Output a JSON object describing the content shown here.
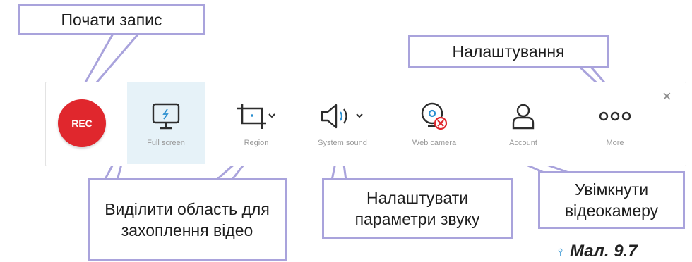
{
  "toolbar": {
    "rec_label": "REC",
    "items": [
      {
        "label": "Full screen",
        "icon": "monitor-icon"
      },
      {
        "label": "Region",
        "icon": "crop-icon"
      },
      {
        "label": "System sound",
        "icon": "speaker-icon"
      },
      {
        "label": "Web camera",
        "icon": "webcam-icon"
      },
      {
        "label": "Account",
        "icon": "person-icon"
      },
      {
        "label": "More",
        "icon": "more-icon"
      }
    ],
    "close_label": "×"
  },
  "callouts": {
    "start_recording": "Почати запис",
    "settings": "Налаштування",
    "select_region": "Виділити область для захоплення відео",
    "sound_settings": "Налаштувати параметри звуку",
    "enable_camera": "Увімкнути відеокамеру"
  },
  "caption": "Мал. 9.7",
  "colors": {
    "rec": "#e0272d",
    "callout_border": "#a9a3dc",
    "active_bg": "#e6f2f8",
    "icon": "#2d2d2d"
  }
}
